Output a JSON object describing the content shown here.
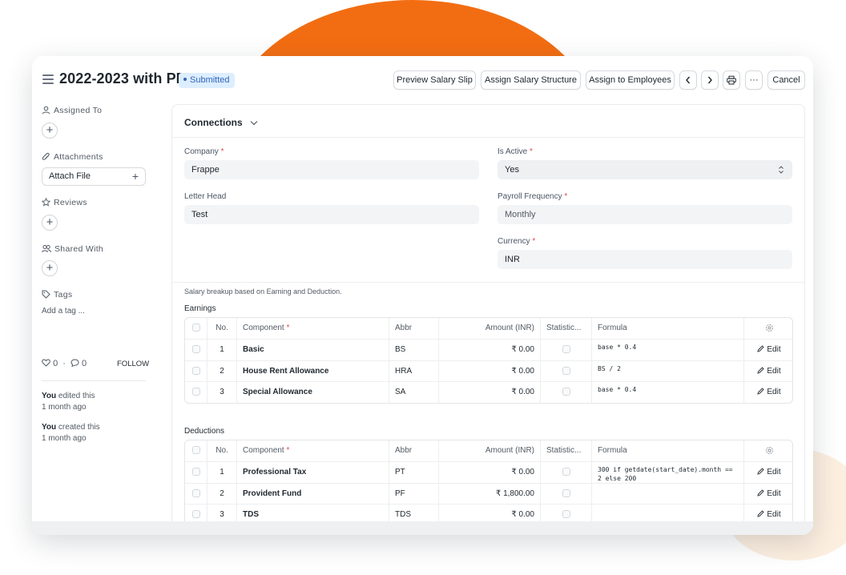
{
  "page": {
    "title": "2022-2023 with PF",
    "status": "Submitted"
  },
  "toolbar": {
    "preview": "Preview Salary Slip",
    "assign_structure": "Assign Salary Structure",
    "assign_employees": "Assign to Employees",
    "more": "···",
    "cancel": "Cancel"
  },
  "sidebar": {
    "assigned_to": "Assigned To",
    "attachments": "Attachments",
    "attach_file": "Attach File",
    "reviews": "Reviews",
    "shared_with": "Shared With",
    "tags": "Tags",
    "add_tag": "Add a tag ...",
    "likes": "0",
    "comments": "0",
    "follow": "FOLLOW",
    "activity": [
      {
        "who": "You",
        "what": " edited this",
        "when": "1 month ago"
      },
      {
        "who": "You",
        "what": " created this",
        "when": "1 month ago"
      }
    ]
  },
  "form": {
    "connections": "Connections",
    "company_label": "Company",
    "company_value": "Frappe",
    "letter_head_label": "Letter Head",
    "letter_head_value": "Test",
    "is_active_label": "Is Active",
    "is_active_value": "Yes",
    "payroll_frequency_label": "Payroll Frequency",
    "payroll_frequency_value": "Monthly",
    "currency_label": "Currency",
    "currency_value": "INR",
    "breakup_note": "Salary breakup based on Earning and Deduction.",
    "earnings_label": "Earnings",
    "deductions_label": "Deductions",
    "edit_label": "Edit"
  },
  "table_headers": {
    "no": "No.",
    "component": "Component",
    "abbr": "Abbr",
    "amount": "Amount (INR)",
    "statistical": "Statistic...",
    "formula": "Formula"
  },
  "earnings": [
    {
      "no": "1",
      "component": "Basic",
      "abbr": "BS",
      "amount": "₹ 0.00",
      "formula": "base * 0.4"
    },
    {
      "no": "2",
      "component": "House Rent Allowance",
      "abbr": "HRA",
      "amount": "₹ 0.00",
      "formula": "BS / 2"
    },
    {
      "no": "3",
      "component": "Special Allowance",
      "abbr": "SA",
      "amount": "₹ 0.00",
      "formula": "base * 0.4"
    }
  ],
  "deductions": [
    {
      "no": "1",
      "component": "Professional Tax",
      "abbr": "PT",
      "amount": "₹ 0.00",
      "formula": "300 if getdate(start_date).month == 2 else 200"
    },
    {
      "no": "2",
      "component": "Provident Fund",
      "abbr": "PF",
      "amount": "₹ 1,800.00",
      "formula": ""
    },
    {
      "no": "3",
      "component": "TDS",
      "abbr": "TDS",
      "amount": "₹ 0.00",
      "formula": ""
    }
  ],
  "colors": {
    "accent_orange": "#f26d12",
    "badge_bg": "#ddeeff",
    "badge_text": "#2e65b7",
    "required": "#e24c4c"
  }
}
